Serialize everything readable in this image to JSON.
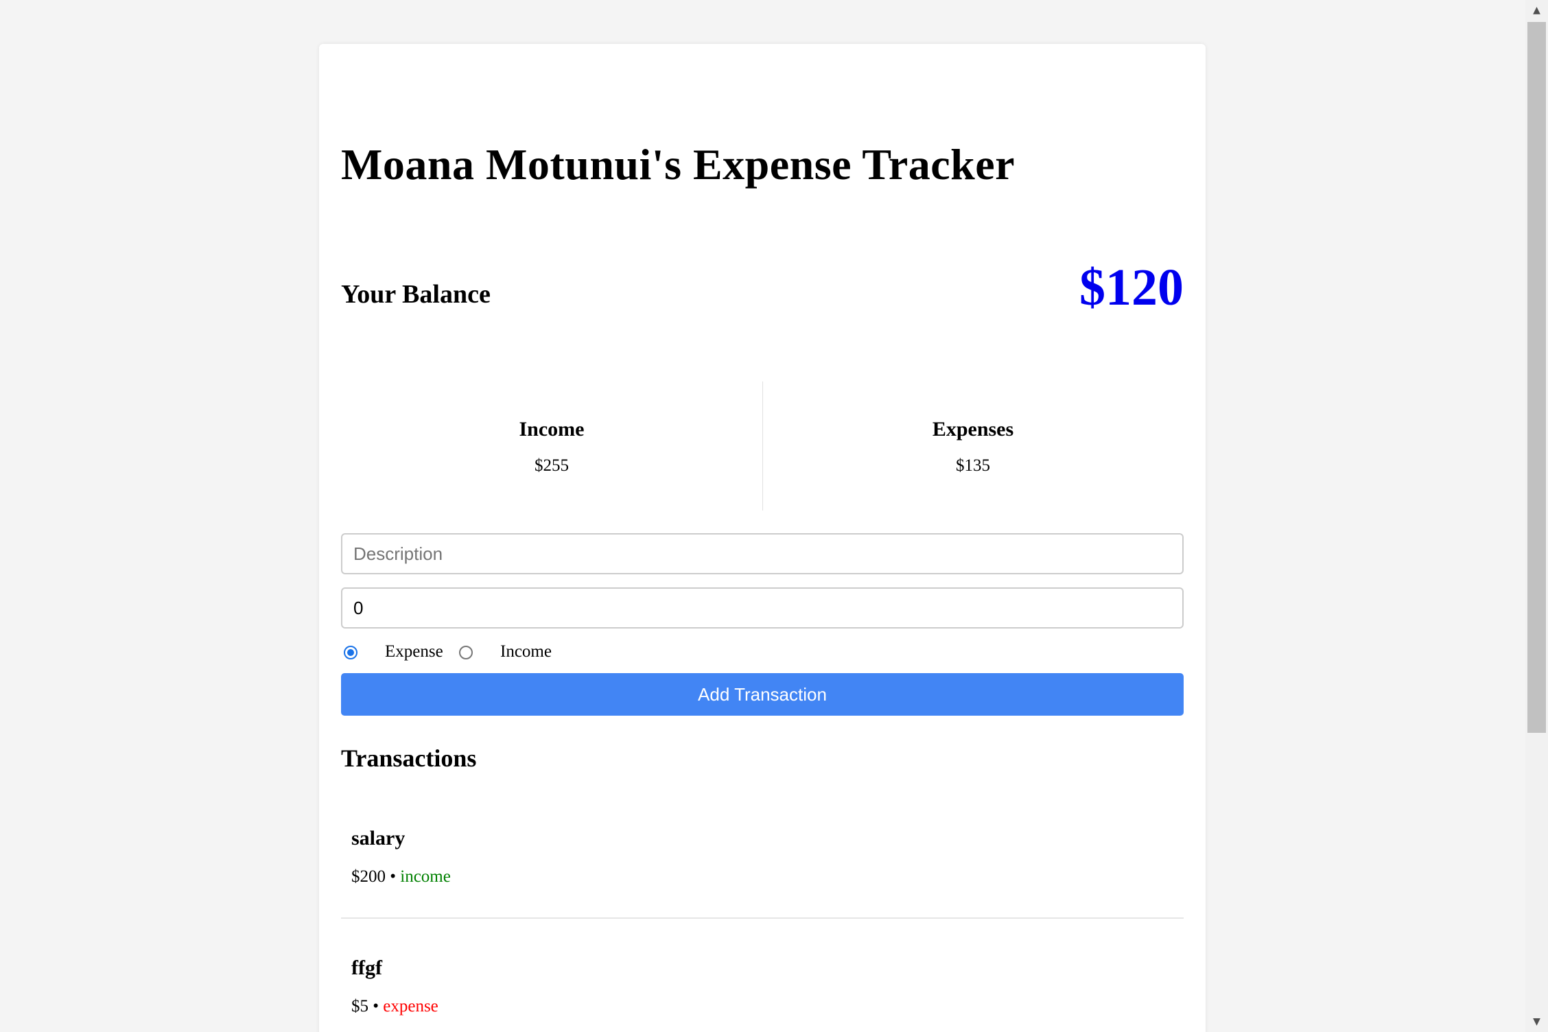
{
  "app": {
    "title": "Moana Motunui's Expense Tracker"
  },
  "balance": {
    "label": "Your Balance",
    "value": "$120"
  },
  "summary": {
    "income": {
      "label": "Income",
      "value": "$255"
    },
    "expenses": {
      "label": "Expenses",
      "value": "$135"
    }
  },
  "form": {
    "description": {
      "placeholder": "Description",
      "value": ""
    },
    "amount": {
      "value": "0"
    },
    "type_options": [
      {
        "label": "Expense",
        "checked": true
      },
      {
        "label": "Income",
        "checked": false
      }
    ],
    "submit_label": "Add Transaction"
  },
  "transactions": {
    "heading": "Transactions",
    "items": [
      {
        "description": "salary",
        "amount": "$200",
        "separator": " • ",
        "type": "income"
      },
      {
        "description": "ffgf",
        "amount": "$5",
        "separator": " • ",
        "type": "expense"
      }
    ]
  },
  "icons": {
    "scroll_up": "triangle-up-icon",
    "scroll_down": "triangle-down-icon"
  },
  "colors": {
    "balance": "#0000ee",
    "income": "#008000",
    "expense": "#ff0000",
    "button": "#4285f4",
    "radio_checked": "#1a73e8"
  }
}
